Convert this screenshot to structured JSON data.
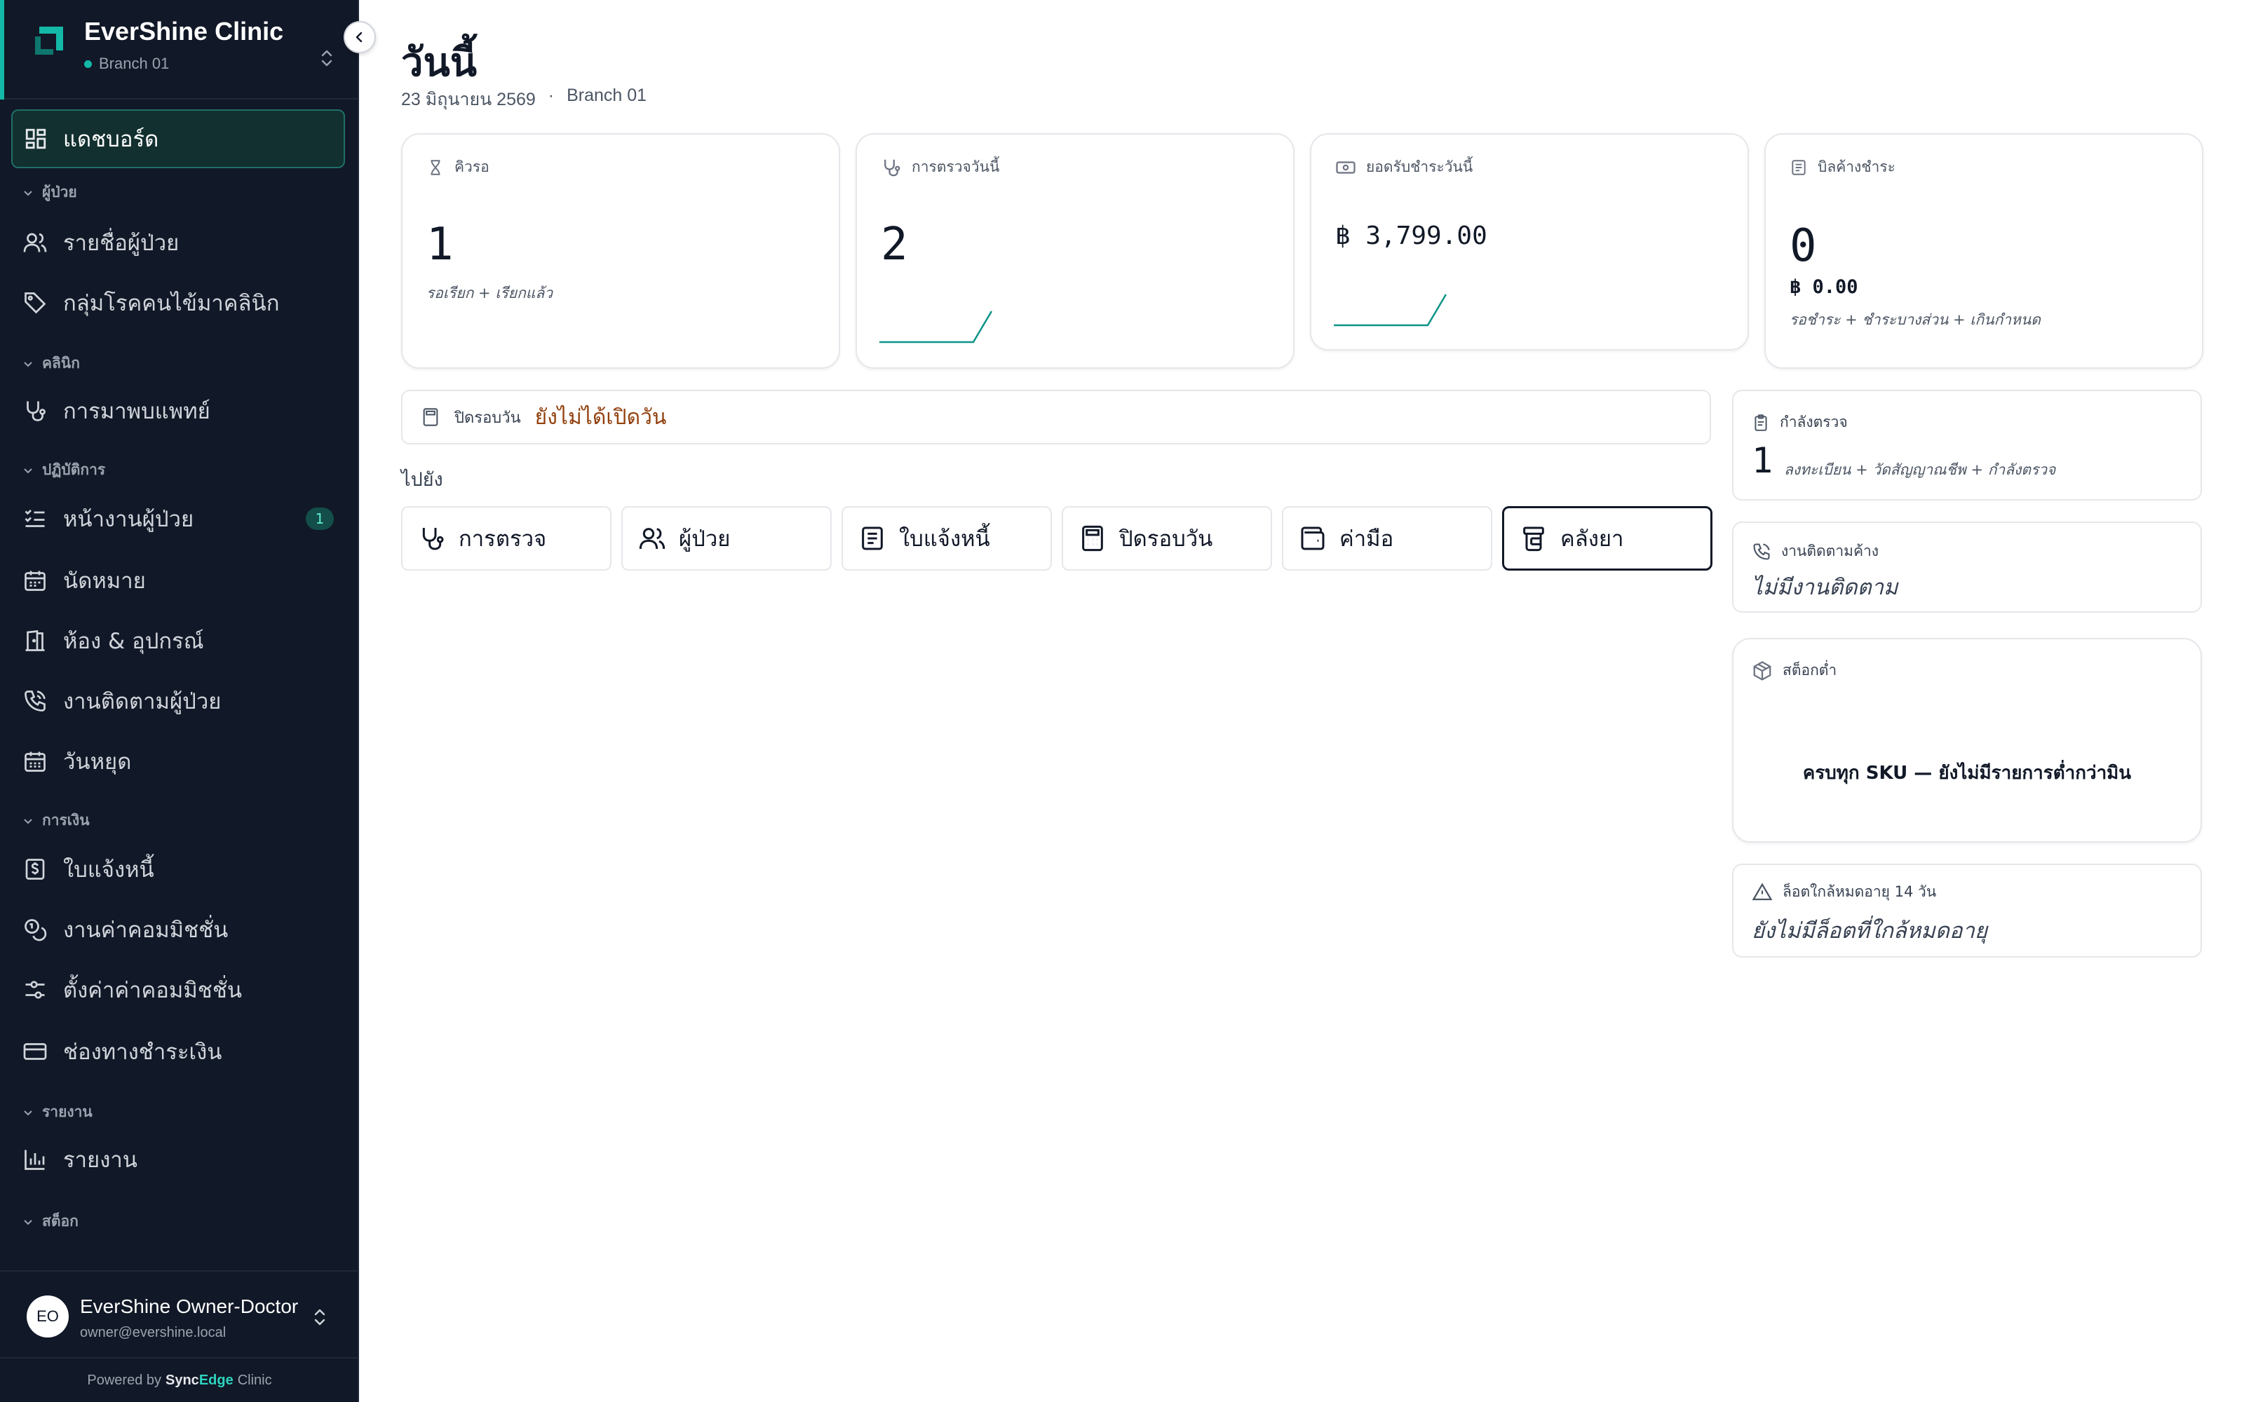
{
  "sidebar": {
    "clinic_name": "EverShine Clinic",
    "branch": "Branch 01",
    "nav": {
      "dashboard": "แดชบอร์ด",
      "sec_patients": "ผู้ป่วย",
      "patient_list": "รายชื่อผู้ป่วย",
      "chronic_groups": "กลุ่มโรคคนไข้มาคลินิก",
      "sec_clinic": "คลินิก",
      "doctor_visits": "การมาพบแพทย์",
      "sec_operations": "ปฏิบัติการ",
      "patient_worklist": "หน้างานผู้ป่วย",
      "patient_worklist_count": "1",
      "appointments": "นัดหมาย",
      "rooms_equipment": "ห้อง & อุปกรณ์",
      "patient_followup": "งานติดตามผู้ป่วย",
      "holidays": "วันหยุด",
      "sec_finance": "การเงิน",
      "invoices": "ใบแจ้งหนี้",
      "commission_jobs": "งานค่าคอมมิชชั่น",
      "commission_settings": "ตั้งค่าค่าคอมมิชชั่น",
      "payment_channels": "ช่องทางชำระเงิน",
      "sec_reports": "รายงาน",
      "reports": "รายงาน",
      "sec_stock": "สต็อก"
    },
    "user": {
      "initials": "EO",
      "name": "EverShine Owner-Doctor",
      "email": "owner@evershine.local"
    },
    "powered_by": "Powered by",
    "brand_sync": "Sync",
    "brand_edge": "Edge",
    "brand_clinic": "Clinic"
  },
  "header": {
    "title": "วันนี้",
    "date": "23 มิถุนายน 2569",
    "separator": "·",
    "branch": "Branch 01"
  },
  "stats": {
    "queue": {
      "label": "คิวรอ",
      "value": "1",
      "note": "รอเรียก + เรียกแล้ว"
    },
    "exams": {
      "label": "การตรวจวันนี้",
      "value": "2"
    },
    "payments": {
      "label": "ยอดรับชำระวันนี้",
      "value": "฿ 3,799.00"
    },
    "bills": {
      "label": "บิลค้างชำระ",
      "value": "0",
      "amount": "฿ 0.00",
      "note": "รอชำระ + ชำระบางส่วน + เกินกำหนด"
    }
  },
  "day_close": {
    "label": "ปิดรอบวัน",
    "status": "ยังไม่ได้เปิดวัน"
  },
  "goto": {
    "label": "ไปยัง",
    "buttons": {
      "exam": "การตรวจ",
      "patients": "ผู้ป่วย",
      "invoices": "ใบแจ้งหนี้",
      "day_close": "ปิดรอบวัน",
      "fees": "ค่ามือ",
      "pharmacy": "คลังยา"
    }
  },
  "right": {
    "in_exam": {
      "label": "กำลังตรวจ",
      "value": "1",
      "note": "ลงทะเบียน + วัดสัญญาณชีพ + กำลังตรวจ"
    },
    "followup": {
      "label": "งานติดตามค้าง",
      "empty": "ไม่มีงานติดตาม"
    },
    "low_stock": {
      "label": "สต็อกต่ำ",
      "message": "ครบทุก SKU — ยังไม่มีรายการต่ำกว่ามิน"
    },
    "expiring": {
      "label": "ล็อตใกล้หมดอายุ 14 วัน",
      "empty": "ยังไม่มีล็อตที่ใกล้หมดอายุ"
    }
  },
  "colors": {
    "sidebar_bg": "#111827",
    "accent": "#14b8a6",
    "warning_text": "#92400e"
  }
}
